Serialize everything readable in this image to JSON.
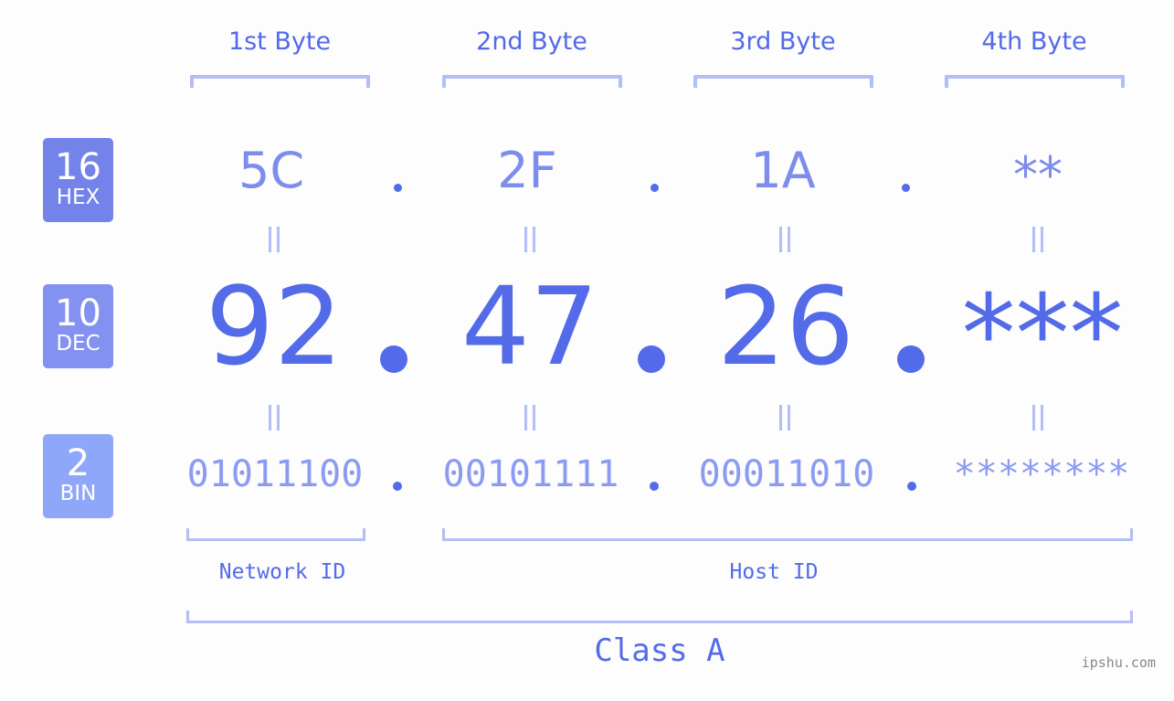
{
  "headers": [
    "1st Byte",
    "2nd Byte",
    "3rd Byte",
    "4th Byte"
  ],
  "badges": [
    {
      "num": "16",
      "label": "HEX",
      "color": "#7383ea"
    },
    {
      "num": "10",
      "label": "DEC",
      "color": "#8392f0"
    },
    {
      "num": "2",
      "label": "BIN",
      "color": "#8fa7f8"
    }
  ],
  "hex": [
    "5C",
    "2F",
    "1A",
    "**"
  ],
  "dec": [
    "92",
    "47",
    "26",
    "***"
  ],
  "bin": [
    "01011100",
    "00101111",
    "00011010",
    "********"
  ],
  "separator": ".",
  "network_label": "Network ID",
  "host_label": "Host ID",
  "class_label": "Class A",
  "watermark": "ipshu.com",
  "colors": {
    "primary": "#546be9",
    "light": "#b3bdf6",
    "hex_text": "#7d8ced",
    "bin_text": "#8c9bf2"
  }
}
